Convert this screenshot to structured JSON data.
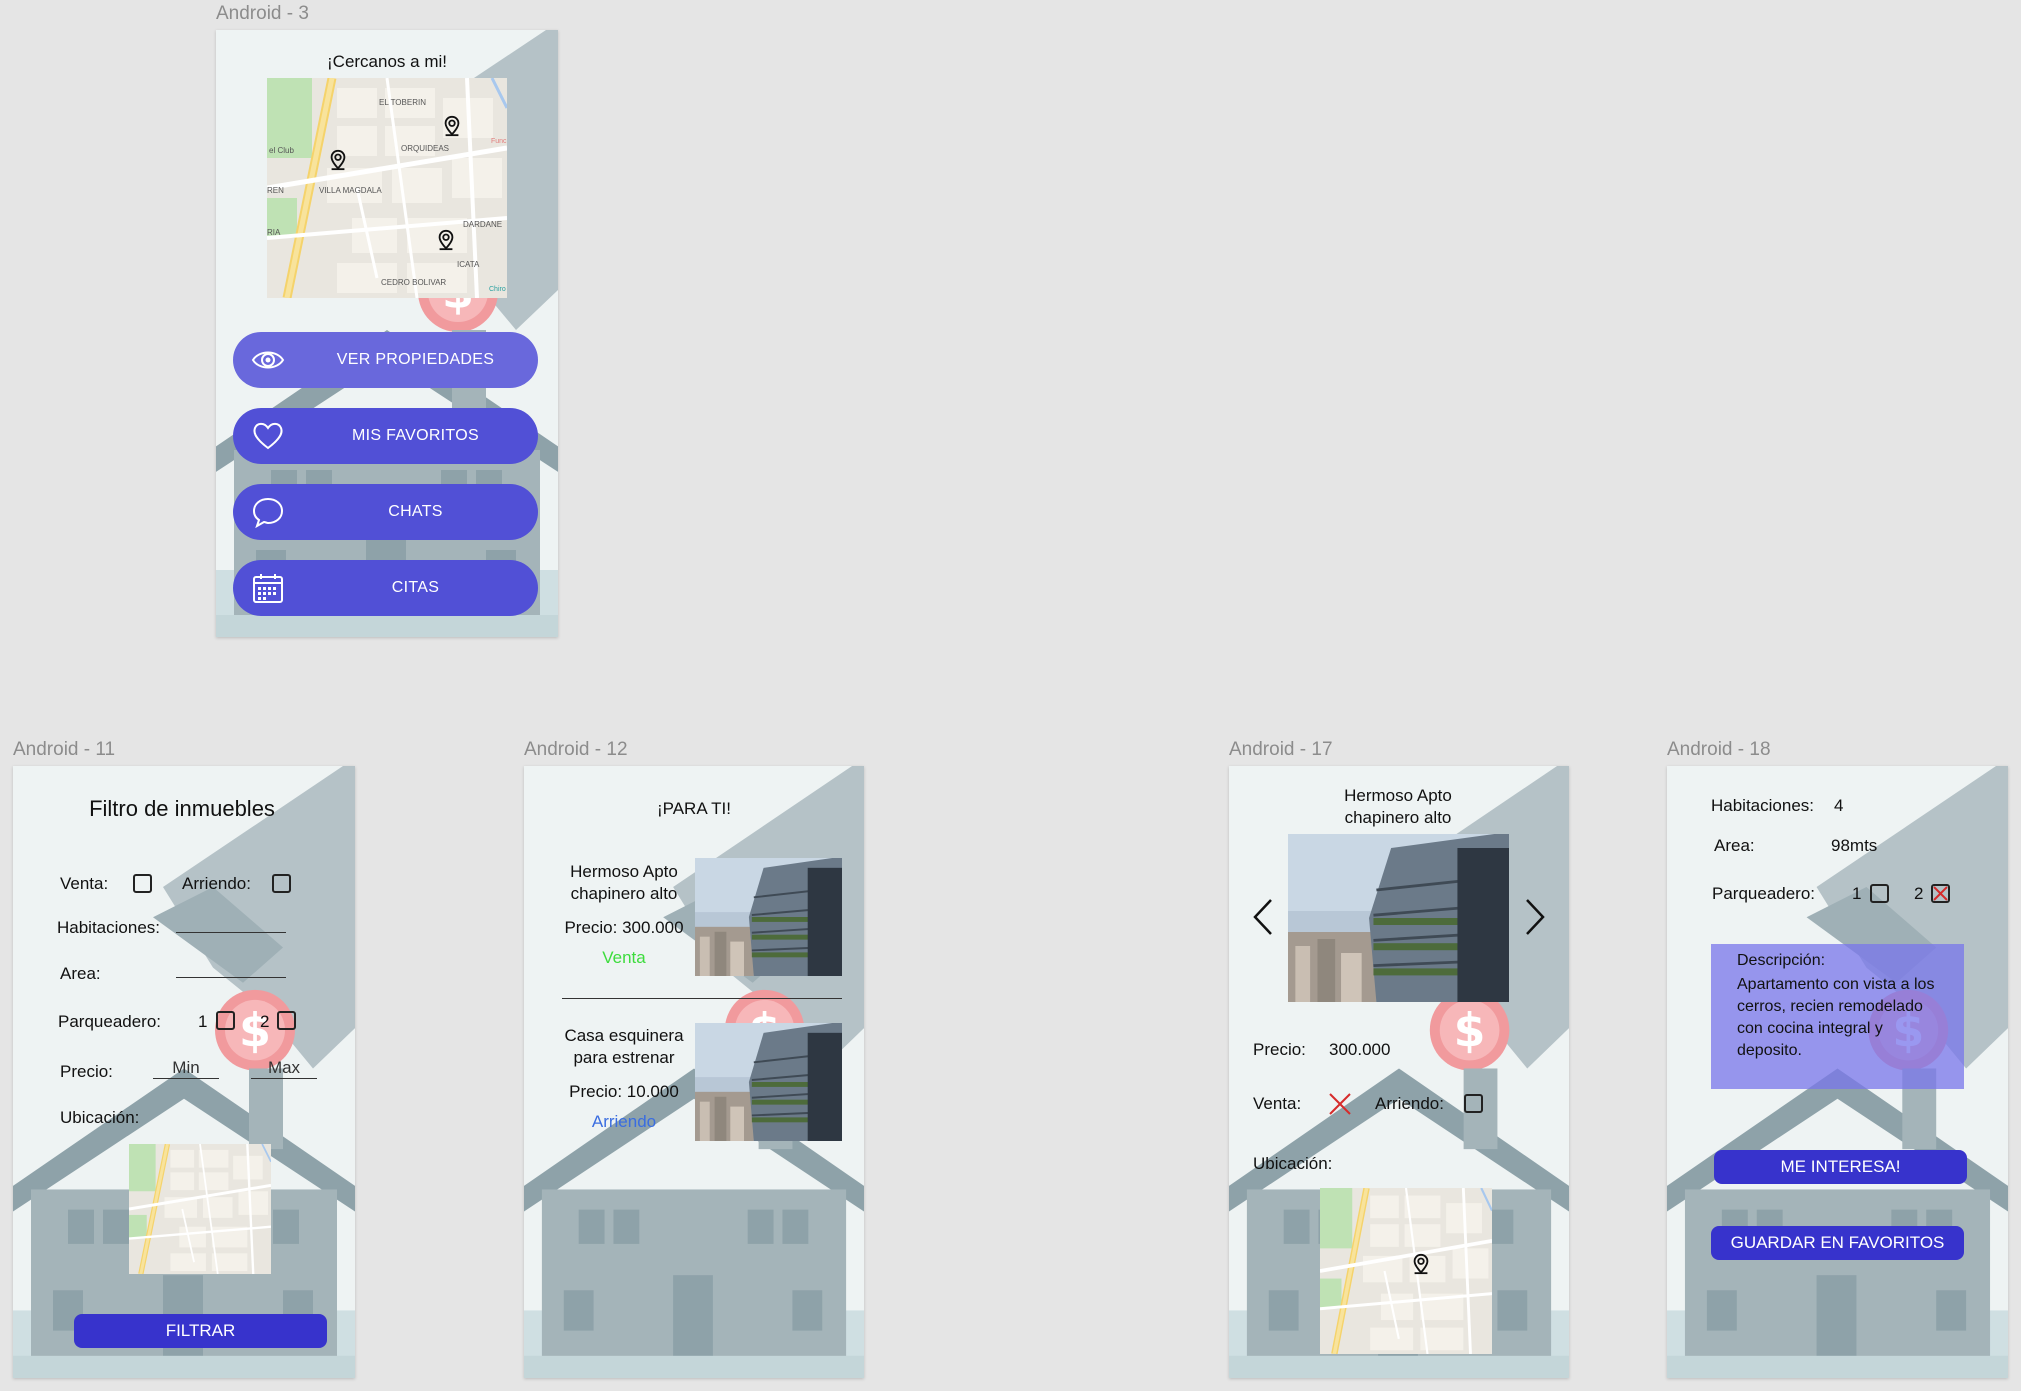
{
  "frames": {
    "a3": {
      "title": "Android - 3"
    },
    "a11": {
      "title": "Android - 11"
    },
    "a12": {
      "title": "Android - 12"
    },
    "a17": {
      "title": "Android - 17"
    },
    "a18": {
      "title": "Android - 18"
    }
  },
  "nearby": {
    "heading": "¡Cercanos a mi!",
    "map_labels": [
      "EL TOBERIN",
      "ORQUIDEAS",
      "VILLA MAGDALA",
      "DARDANE",
      "ICATA",
      "CEDRO BOLIVAR",
      "el Club",
      "REN",
      "RIA",
      "Chiro",
      "Func"
    ],
    "buttons": [
      {
        "label": "VER PROPIEDADES",
        "icon": "eye-icon"
      },
      {
        "label": "MIS FAVORITOS",
        "icon": "heart-icon"
      },
      {
        "label": "CHATS",
        "icon": "chat-bubble-icon"
      },
      {
        "label": "CITAS",
        "icon": "calendar-icon"
      }
    ]
  },
  "filter": {
    "title": "Filtro de inmuebles",
    "venta_label": "Venta:",
    "arriendo_label": "Arriendo:",
    "habitaciones_label": "Habitaciones:",
    "area_label": "Area:",
    "parqueadero_label": "Parqueadero:",
    "parq_opt1": "1",
    "parq_opt2": "2",
    "precio_label": "Precio:",
    "min_placeholder": "Min",
    "max_placeholder": "Max",
    "ubicacion_label": "Ubicación:",
    "filter_button": "FILTRAR"
  },
  "for_you": {
    "heading": "¡PARA TI!",
    "listings": [
      {
        "title_line1": "Hermoso Apto",
        "title_line2": "chapinero alto",
        "price": "Precio: 300.000",
        "status": "Venta",
        "status_color": "#3ddc3d"
      },
      {
        "title_line1": "Casa esquinera",
        "title_line2": "para estrenar",
        "price": "Precio: 10.000",
        "status": "Arriendo",
        "status_color": "#3a6de0"
      }
    ]
  },
  "detail": {
    "title_line1": "Hermoso Apto",
    "title_line2": "chapinero alto",
    "precio_label": "Precio:",
    "precio_value": "300.000",
    "venta_label": "Venta:",
    "arriendo_label": "Arriendo:",
    "ubicacion_label": "Ubicación:",
    "venta_checked": true,
    "arriendo_checked": false
  },
  "detail2": {
    "habitaciones_label": "Habitaciones:",
    "habitaciones_value": "4",
    "area_label": "Area:",
    "area_value": "98mts",
    "parqueadero_label": "Parqueadero:",
    "parq_opt1": "1",
    "parq_opt2": "2",
    "parq_opt2_checked": true,
    "descripcion_label": "Descripción:",
    "descripcion_text": "Apartamento con vista a los cerros, recien remodelado con cocina integral y deposito.",
    "interest_button": "ME INTERESA!",
    "favorite_button": "GUARDAR EN FAVORITOS"
  },
  "colors": {
    "accent": "#3733cc",
    "menu_button": "#5150d6",
    "canvas": "#e5e5e5",
    "description_box": "#8a89e6",
    "checked_cross": "#d62b2b"
  }
}
